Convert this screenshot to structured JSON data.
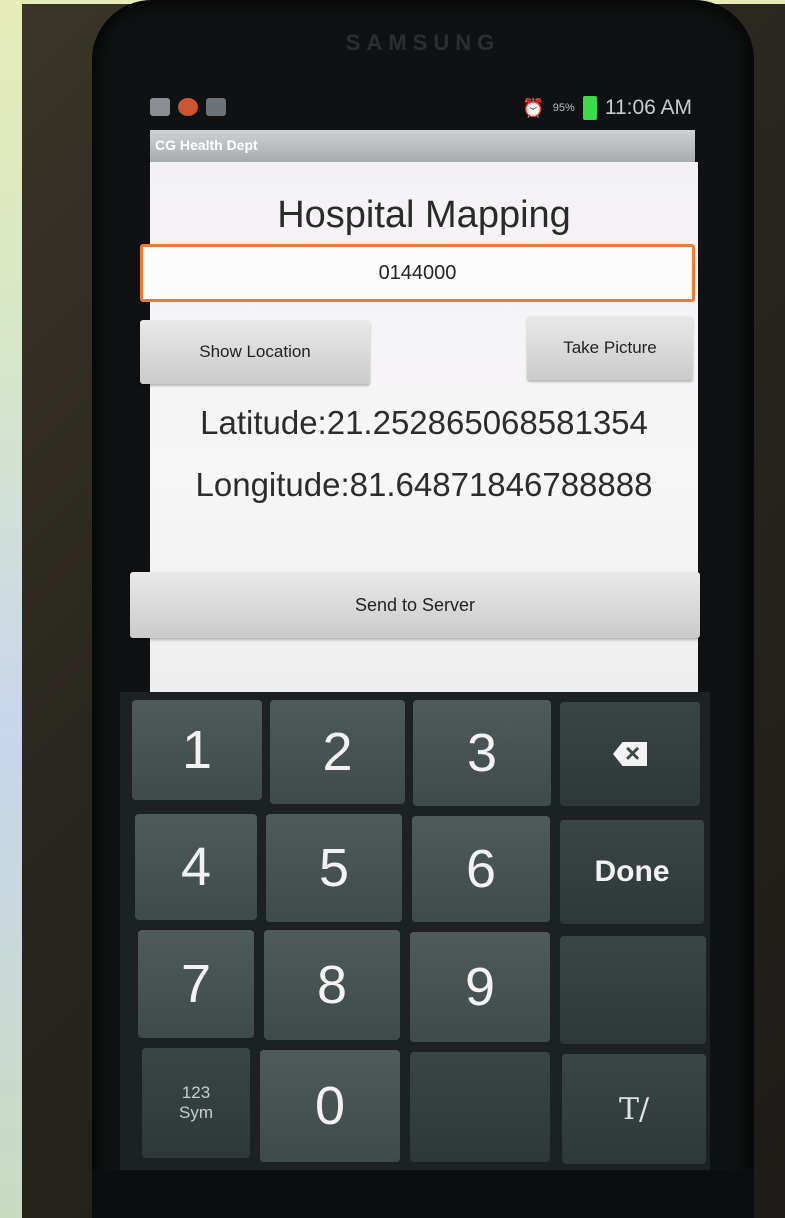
{
  "device": {
    "brand": "SAMSUNG"
  },
  "status_bar": {
    "battery": "95%",
    "time": "11:06 AM",
    "signal_label": "95%"
  },
  "app": {
    "window_title": "CG Health Dept",
    "heading": "Hospital Mapping",
    "code_value": "0144000",
    "show_location_label": "Show Location",
    "take_picture_label": "Take Picture",
    "latitude_text": "Latitude:21.252865068581354",
    "longitude_text": "Longitude:81.64871846788888",
    "send_label": "Send to Server"
  },
  "keypad": {
    "keys": [
      "1",
      "2",
      "3",
      "4",
      "5",
      "6",
      "7",
      "8",
      "9",
      "0"
    ],
    "done_label": "Done",
    "sym_line1": "123",
    "sym_line2": "Sym"
  },
  "icons": {
    "backspace": "backspace-icon",
    "text_mode": "text-mode-icon"
  },
  "colors": {
    "input_border": "#ec7a3c",
    "battery": "#3dd94a",
    "keypad_bg": "#1c2224"
  }
}
